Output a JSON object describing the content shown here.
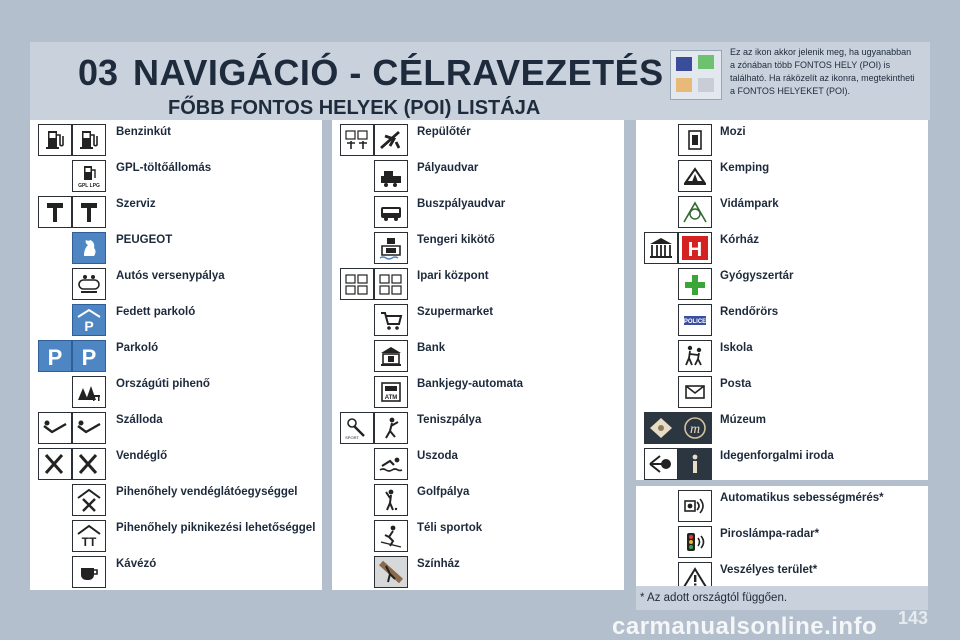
{
  "header": {
    "chapter": "03",
    "title": "NAVIGÁCIÓ - CÉLRAVEZETÉS",
    "subtitle": "FŐBB FONTOS HELYEK (POI) LISTÁJA"
  },
  "note": {
    "lines": [
      "Ez az ikon akkor jelenik meg, ha ugyanabban",
      "a zónában több FONTOS HELY (POI) is",
      "található. Ha ráközelít az ikonra, megtekintheti",
      "a FONTOS HELYEKET (POI)."
    ],
    "thumb_colors": [
      "#3b4d9a",
      "#6ec16e",
      "#e9b979",
      "#e3e8ee"
    ]
  },
  "columns": [
    {
      "items": [
        {
          "label": "Benzinkút",
          "icons": [
            "fuel-pump-icon",
            "fuel-pump-icon"
          ]
        },
        {
          "label": "GPL-töltőállomás",
          "icons": [
            "gpl-fuel-icon"
          ]
        },
        {
          "label": "Szerviz",
          "icons": [
            "wrench-icon",
            "wrench-icon"
          ]
        },
        {
          "label": "PEUGEOT",
          "icons": [
            "lion-icon"
          ]
        },
        {
          "label": "Autós versenypálya",
          "icons": [
            "race-track-icon"
          ]
        },
        {
          "label": "Fedett parkoló",
          "icons": [
            "covered-parking-icon"
          ]
        },
        {
          "label": "Parkoló",
          "icons": [
            "parking-icon",
            "parking-icon"
          ]
        },
        {
          "label": "Országúti pihenő",
          "icons": [
            "rest-area-icon"
          ]
        },
        {
          "label": "Szálloda",
          "icons": [
            "bed-icon",
            "bed-icon"
          ]
        },
        {
          "label": "Vendéglő",
          "icons": [
            "cutlery-icon",
            "cutlery-icon"
          ]
        },
        {
          "label": "Pihenőhely vendéglátóegységgel",
          "icons": [
            "rest-restaurant-icon"
          ]
        },
        {
          "label": "Pihenőhely piknikezési lehetőséggel",
          "icons": [
            "rest-picnic-icon"
          ]
        },
        {
          "label": "Kávézó",
          "icons": [
            "coffee-cup-icon"
          ]
        }
      ]
    },
    {
      "items": [
        {
          "label": "Repülőtér",
          "icons": [
            "airport-icon",
            "airplane-icon"
          ]
        },
        {
          "label": "Pályaudvar",
          "icons": [
            "train-icon"
          ]
        },
        {
          "label": "Buszpályaudvar",
          "icons": [
            "bus-icon"
          ]
        },
        {
          "label": "Tengeri kikötő",
          "icons": [
            "harbour-icon"
          ]
        },
        {
          "label": "Ipari központ",
          "icons": [
            "industry-icon",
            "industry-icon"
          ]
        },
        {
          "label": "Szupermarket",
          "icons": [
            "shopping-cart-icon"
          ]
        },
        {
          "label": "Bank",
          "icons": [
            "bank-icon"
          ]
        },
        {
          "label": "Bankjegy-automata",
          "icons": [
            "atm-icon"
          ]
        },
        {
          "label": "Teniszpálya",
          "icons": [
            "tennis-icon",
            "tennis-player-icon"
          ]
        },
        {
          "label": "Uszoda",
          "icons": [
            "swimmer-icon"
          ]
        },
        {
          "label": "Golfpálya",
          "icons": [
            "golfer-icon"
          ]
        },
        {
          "label": "Téli sportok",
          "icons": [
            "skier-icon"
          ]
        },
        {
          "label": "Színház",
          "icons": [
            "theatre-icon"
          ]
        }
      ]
    },
    {
      "items": [
        {
          "label": "Mozi",
          "icons": [
            "film-icon"
          ]
        },
        {
          "label": "Kemping",
          "icons": [
            "camping-icon"
          ]
        },
        {
          "label": "Vidámpark",
          "icons": [
            "amusement-park-icon"
          ]
        },
        {
          "label": "Kórház",
          "icons": [
            "hospital-building-icon",
            "hospital-h-icon"
          ]
        },
        {
          "label": "Gyógyszertár",
          "icons": [
            "pharmacy-cross-icon"
          ]
        },
        {
          "label": "Rendőrörs",
          "icons": [
            "police-icon"
          ]
        },
        {
          "label": "Iskola",
          "icons": [
            "school-children-icon"
          ]
        },
        {
          "label": "Posta",
          "icons": [
            "envelope-icon"
          ]
        },
        {
          "label": "Múzeum",
          "icons": [
            "museum-icon",
            "museum-m-icon"
          ]
        },
        {
          "label": "Idegenforgalmi iroda",
          "icons": [
            "tourist-info-icon",
            "info-icon"
          ]
        },
        {
          "label": "Automatikus sebességmérés*",
          "icons": [
            "speed-camera-icon"
          ]
        },
        {
          "label": "Piroslámpa-radar*",
          "icons": [
            "traffic-light-radar-icon"
          ]
        },
        {
          "label": "Veszélyes terület*",
          "icons": [
            "warning-triangle-icon"
          ]
        }
      ]
    }
  ],
  "footnote": "* Az adott országtól függően.",
  "page_number": "143",
  "watermark": "carmanualsonline.info"
}
